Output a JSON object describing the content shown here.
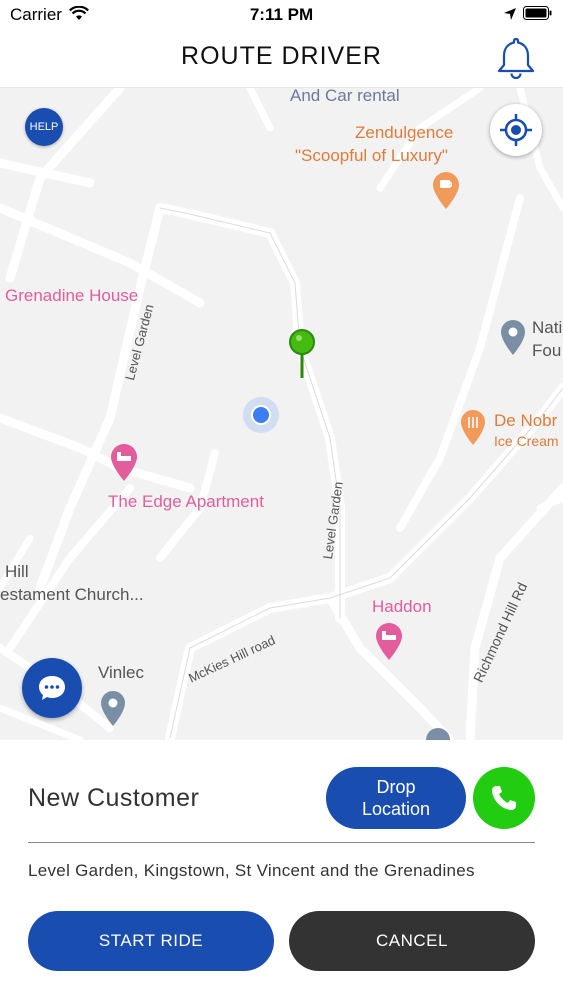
{
  "status_bar": {
    "carrier": "Carrier",
    "time": "7:11 PM"
  },
  "nav": {
    "title": "ROUTE DRIVER",
    "bell_icon": "bell-icon"
  },
  "map": {
    "help_label": "HELP",
    "labels": {
      "car_rental": "And Car rental",
      "zendulgence": "Zendulgence",
      "scoopful": "\"Scoopful of Luxury\"",
      "grenadine": "Grenadine House",
      "level_garden_1": "Level Garden",
      "level_garden_2": "Level Garden",
      "nati": "Nati",
      "fou": "Fou",
      "de_nobr": "De Nobr",
      "ice_cream": "Ice Cream",
      "edge": "The Edge Apartment",
      "hill": "Hill",
      "church": "estament Church...",
      "richmond": "Richmond Hill Rd",
      "haddon": "Haddon",
      "mckies": "McKies Hill road",
      "vinlec": "Vinlec"
    },
    "colors": {
      "poi_pink": "#e35d9c",
      "poi_orange": "#e07b39",
      "pin_green": "#33aa11",
      "user_dot": "#3b7ef0"
    }
  },
  "ride": {
    "customer_name": "New Customer",
    "drop_label": "Drop Location",
    "address": "Level Garden, Kingstown, St Vincent and the Grenadines",
    "start_label": "START RIDE",
    "cancel_label": "CANCEL"
  },
  "colors": {
    "primary": "#1a4db0",
    "call_green": "#22cc11",
    "cancel_dark": "#333333"
  }
}
